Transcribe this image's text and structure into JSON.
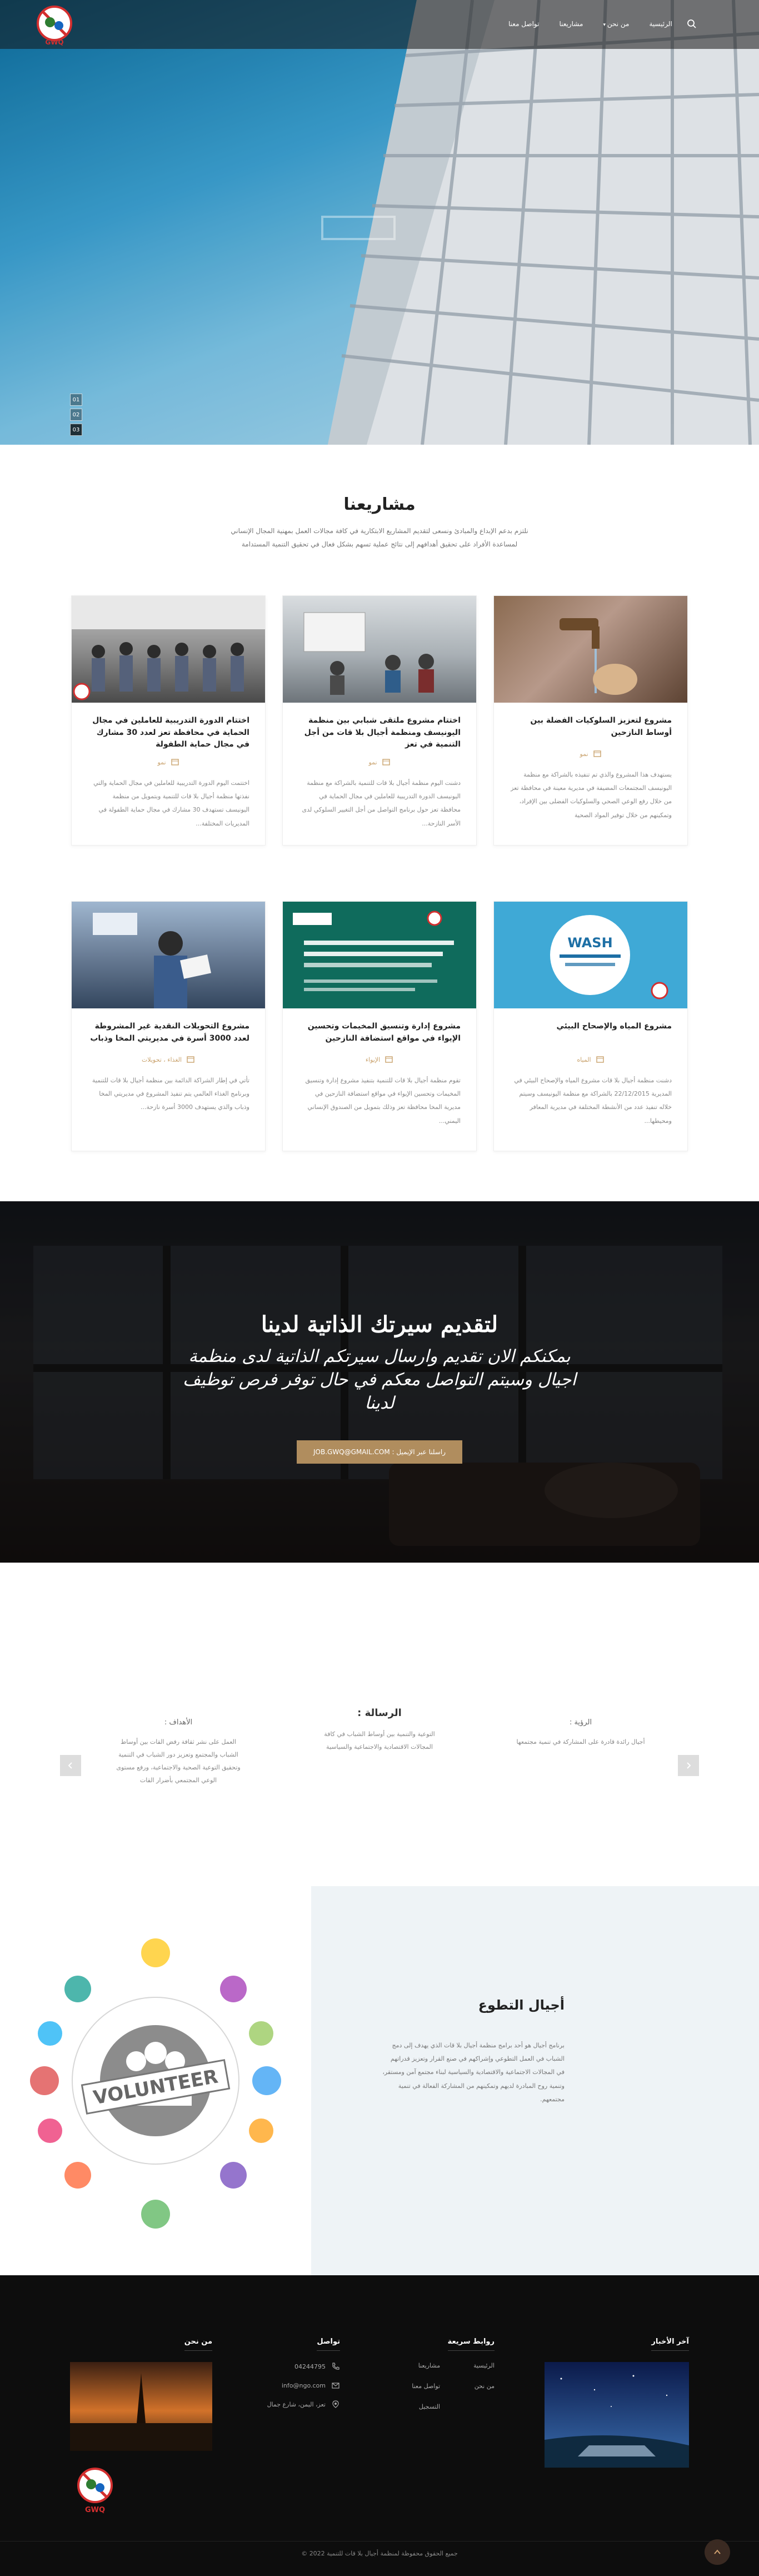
{
  "nav": {
    "items": [
      {
        "label": "الرئيسية",
        "dropdown": false
      },
      {
        "label": "من نحن",
        "dropdown": true
      },
      {
        "label": "مشاريعنا",
        "dropdown": false
      },
      {
        "label": "تواصل معنا",
        "dropdown": false
      }
    ]
  },
  "hero": {
    "slides": [
      "01",
      "02",
      "03"
    ],
    "active_slide": 2
  },
  "projects": {
    "title": "مشاريعنا",
    "subtitle": "نلتزم بدعم الإبداع والمبادئ ونسعى لتقديم المشاريع الابتكارية في كافة مجالات العمل بمهنية المجال الإنساني لمساعدة الأفراد على تحقيق أهدافهم إلى نتائج عملية تسهم بشكل فعال في تحقيق التنمية المستدامة",
    "items": [
      {
        "title": "مشروع لتعزيز السلوكيات الفضلة بين أوساط النازحين",
        "category": "نمو",
        "text": "يستهدف هذا المشروع والذي تم تنفيذه بالشراكة مع منظمة اليونيسف المجتمعات المضيفة في مديرية معينة في محافظة تعز من خلال رفع الوعي الصحي والسلوكيات الفضلى بين الإفراد، وتمكينهم من خلال توفير المواد الصحية"
      },
      {
        "title": "اختتام مشروع ملتقى شبابي بين منظمة اليونيسف ومنظمة أجيال بلا قات من أجل التنمية في تعز",
        "category": "نمو",
        "text": "دشنت اليوم منظمة أجيال بلا قات للتنمية بالشراكة مع منظمة اليونيسف الدورة التدريبية للعاملين في مجال الحماية في محافظة تعز حول برنامج التواصل من أجل التغيير السلوكي لدى الأسر النازحة..."
      },
      {
        "title": "اختتام الدورة التدريبية للعاملين في مجال الحماية في محافظة تعز لعدد 30 مشارك في مجال حماية الطفولة",
        "category": "نمو",
        "text": "اختتمت اليوم الدورة التدريبية للعاملين في مجال الحماية والتي نفذتها منظمة أجيال بلا قات للتنمية وبتمويل من منظمة اليونيسف تستهدف 30 مشارك في مجال حماية الطفولة في المديريات المختلفة..."
      },
      {
        "title": "مشروع المياه والإصحاح البيئي",
        "category": "المياه",
        "text": "دشنت منظمة أجيال بلا قات مشروع المياه والإصحاح البيئي في المديرية 22/12/2015 بالشراكة مع منظمة اليونيسف وسيتم خلاله تنفيذ عدد من الأنشطة المختلفة في مديرية المعافر ومحيطها..."
      },
      {
        "title": "مشروع إدارة وتنسيق المخيمات وتحسين الإيواء في مواقع استضافة النازحين",
        "category": "الإيواء",
        "text": "تقوم منظمة أجيال بلا قات للتنمية بتنفيذ مشروع إدارة وتنسيق المخيمات وتحسين الإيواء في مواقع استضافة النازحين في مديرية المخا محافظة تعز وذلك بتمويل من الصندوق الإنساني اليمني..."
      },
      {
        "title": "مشروع التحويلات النقدية غير المشروطة لعدد 3000 أسرة في مديريتي المخا وذباب",
        "category": "الغذاء ، تحويلات",
        "text": "تأتي في إطار الشراكة الدائمة بين منظمة أجيال بلا قات للتنمية وبرنامج الغذاء العالمي يتم تنفيذ المشروع في مديريتي المخا وذباب والذي يستهدف 3000 أسرة نازحة..."
      }
    ]
  },
  "cv": {
    "title": "لتقديم سيرتك الذاتية لدينا",
    "text": "بمكنكم الان تقديم وارسال سيرتكم الذاتية لدى منظمة اجيال وسيتم التواصل معكم في حال توفر فرص توظيف لدينا",
    "button": "راسلنا عبر الإيميل : JOB.GWQ@GMAIL.COM"
  },
  "vmg": {
    "vision": {
      "title": "الرؤية :",
      "text": "أجيال رائدة قادرة على المشاركة في تنمية مجتمعها"
    },
    "mission": {
      "title": "الرسالة :",
      "text": "التوعية والتنمية بين أوساط الشباب في كافة المجالات الاقتصادية والاجتماعية والسياسية"
    },
    "goals": {
      "title": "الأهداف :",
      "text": "العمل على نشر ثقافة رفض القات بين أوساط الشباب والمجتمع وتعزيز دور الشباب في التنمية وتحقيق التوعية الصحية والاجتماعية، ورفع مستوى الوعي المجتمعي بأضرار القات"
    }
  },
  "volunteer": {
    "title": "أجيال التطوع",
    "text": "برنامج أجيال هو أحد برامج منظمة أجيال بلا قات الذي يهدف إلى دمج الشباب في العمل التطوعي وإشراكهم في صنع القرار وتعزيز قدراتهم في المجالات الاجتماعية والاقتصادية والسياسية لبناء مجتمع آمن ومستقر، وتنمية روح المبادرة لديهم وتمكينهم من المشاركة الفعالة في تنمية مجتمعهم.",
    "badge_text": "VOLUNTEER"
  },
  "footer": {
    "col_latest": {
      "title": "آخر الأخبار"
    },
    "col_links": {
      "title": "روابط سريعة",
      "links": [
        "الرئيسية",
        "من نحن",
        "مشاريعنا",
        "تواصل معنا",
        "التسجيل"
      ]
    },
    "col_contact": {
      "title": "تواصل",
      "phone": "04244795",
      "email": "info@ngo.com",
      "address": "تعز، اليمن، شارع جمال"
    },
    "col_about": {
      "title": "من نحن"
    },
    "logo_text": "GWQ",
    "copyright": "جميع الحقوق محفوظة لمنظمة أجيال بلا قات للتنمية 2022 ©"
  }
}
